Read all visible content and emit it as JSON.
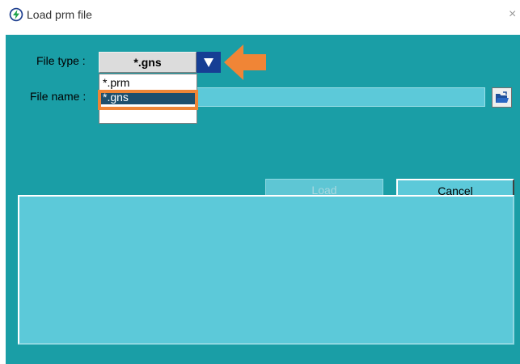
{
  "window": {
    "title": "Load prm file",
    "close_glyph": "×",
    "app_icon": "app-logo-icon"
  },
  "form": {
    "file_type_label": "File type :",
    "file_type_value": "*.gns",
    "file_type_options": [
      "*.prm",
      "*.gns"
    ],
    "file_type_selected_index": 1,
    "file_name_label": "File name :",
    "file_name_value": "",
    "browse_icon": "open-folder-icon"
  },
  "buttons": {
    "load": "Load",
    "cancel": "Cancel"
  },
  "log": {
    "text": ""
  },
  "colors": {
    "background": "#1a9ea6",
    "field": "#5cc9d9",
    "dropdown_arrow": "#163e94",
    "selection": "#1f4f6d",
    "annotation": "#f08536"
  }
}
